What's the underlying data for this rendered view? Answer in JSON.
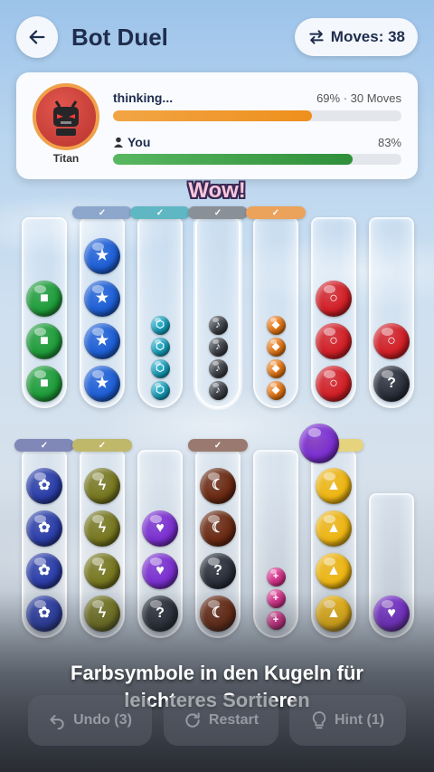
{
  "header": {
    "title": "Bot Duel",
    "moves_label": "Moves: 38"
  },
  "opponent": {
    "name": "Titan",
    "status": "thinking...",
    "stats": "69% · 30 Moves",
    "progress": 0.69
  },
  "player": {
    "label": "You",
    "stats": "83%",
    "progress": 0.83
  },
  "celebration": "Wow!",
  "caption": [
    "Farbsymbole in den Kugeln für",
    "leichteres Sortieren"
  ],
  "buttons": {
    "undo": "Undo (3)",
    "restart": "Restart",
    "hint": "Hint (1)"
  },
  "colors": {
    "green": "#1f9d3a",
    "blue": "#1e5fd6",
    "cyan": "#15a6c4",
    "gray": "#3c3f45",
    "orange": "#f07a12",
    "red": "#d31f26",
    "navy": "#2b3ea8",
    "olive": "#77771f",
    "purple": "#7b2fd0",
    "black": "#2a2f3a",
    "brown": "#6b2a12",
    "pink": "#e0308f",
    "yellow": "#efb612"
  },
  "tubes_top": [
    {
      "completed": false,
      "balls": [
        {
          "c": "green",
          "s": "■"
        },
        {
          "c": "green",
          "s": "■"
        },
        {
          "c": "green",
          "s": "■"
        }
      ]
    },
    {
      "completed": true,
      "cap": "#8da6cc",
      "balls": [
        {
          "c": "blue",
          "s": "★"
        },
        {
          "c": "blue",
          "s": "★"
        },
        {
          "c": "blue",
          "s": "★"
        },
        {
          "c": "blue",
          "s": "★"
        }
      ]
    },
    {
      "completed": true,
      "cap": "#5fb7c3",
      "balls": [
        {
          "c": "cyan",
          "s": "⬡"
        },
        {
          "c": "cyan",
          "s": "⬡"
        },
        {
          "c": "cyan",
          "s": "⬡"
        },
        {
          "c": "cyan",
          "s": "⬡"
        }
      ]
    },
    {
      "completed": true,
      "cap": "#8a9097",
      "selected": true,
      "balls": [
        {
          "c": "gray",
          "s": "♪"
        },
        {
          "c": "gray",
          "s": "♪"
        },
        {
          "c": "gray",
          "s": "♪"
        },
        {
          "c": "gray",
          "s": "♪"
        }
      ]
    },
    {
      "completed": true,
      "cap": "#eba25a",
      "balls": [
        {
          "c": "orange",
          "s": "◆"
        },
        {
          "c": "orange",
          "s": "◆"
        },
        {
          "c": "orange",
          "s": "◆"
        },
        {
          "c": "orange",
          "s": "◆"
        }
      ]
    },
    {
      "completed": false,
      "balls": [
        {
          "c": "red",
          "s": "○"
        },
        {
          "c": "red",
          "s": "○"
        },
        {
          "c": "red",
          "s": "○"
        }
      ]
    },
    {
      "completed": false,
      "balls": [
        {
          "c": "red",
          "s": "○"
        },
        {
          "c": "black",
          "s": "?"
        }
      ]
    }
  ],
  "tubes_bottom": [
    {
      "completed": true,
      "cap": "#8088b8",
      "balls": [
        {
          "c": "navy",
          "s": "✿"
        },
        {
          "c": "navy",
          "s": "✿"
        },
        {
          "c": "navy",
          "s": "✿"
        },
        {
          "c": "navy",
          "s": "✿"
        }
      ]
    },
    {
      "completed": true,
      "cap": "#bfb86a",
      "balls": [
        {
          "c": "olive",
          "s": "ϟ"
        },
        {
          "c": "olive",
          "s": "ϟ"
        },
        {
          "c": "olive",
          "s": "ϟ"
        },
        {
          "c": "olive",
          "s": "ϟ"
        }
      ]
    },
    {
      "completed": false,
      "balls": [
        {
          "c": "purple",
          "s": "♥"
        },
        {
          "c": "purple",
          "s": "♥"
        },
        {
          "c": "black",
          "s": "?"
        }
      ]
    },
    {
      "completed": true,
      "cap": "#9a7a70",
      "balls": [
        {
          "c": "brown",
          "s": "☾"
        },
        {
          "c": "brown",
          "s": "☾"
        },
        {
          "c": "black",
          "s": "?"
        },
        {
          "c": "brown",
          "s": "☾"
        }
      ]
    },
    {
      "completed": false,
      "balls": [
        {
          "c": "pink",
          "s": "+"
        },
        {
          "c": "pink",
          "s": "+"
        },
        {
          "c": "pink",
          "s": "+"
        }
      ]
    },
    {
      "completed": true,
      "cap": "#e6d37e",
      "balls": [
        {
          "c": "yellow",
          "s": "▲"
        },
        {
          "c": "yellow",
          "s": "▲"
        },
        {
          "c": "yellow",
          "s": "▲"
        },
        {
          "c": "yellow",
          "s": "▲"
        }
      ]
    },
    {
      "completed": false,
      "balls": [
        {
          "c": "purple",
          "s": "♥"
        }
      ]
    }
  ],
  "floating_ball": {
    "c": "purple",
    "s": ""
  }
}
